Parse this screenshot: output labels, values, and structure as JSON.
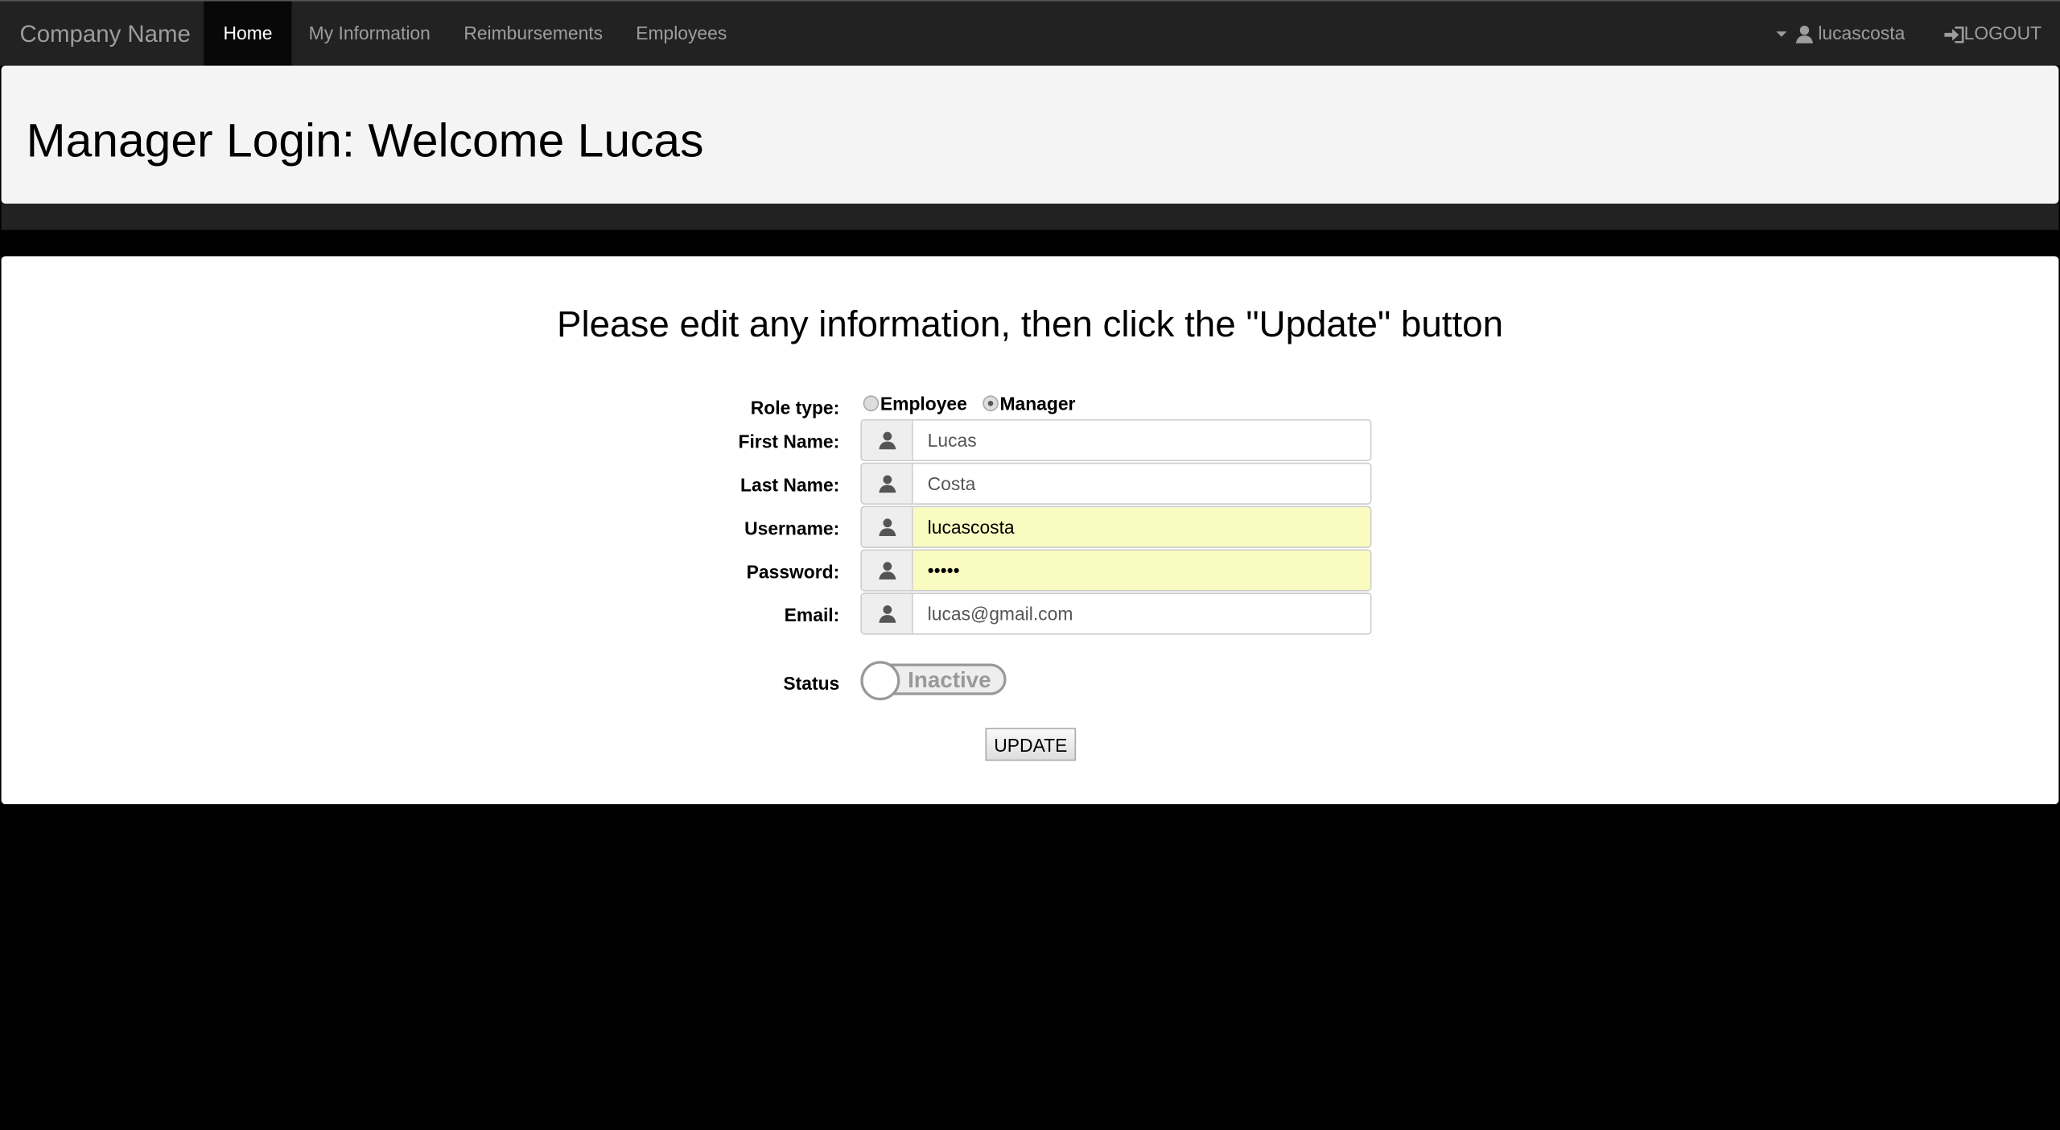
{
  "navbar": {
    "brand": "Company Name",
    "links": [
      {
        "label": "Home",
        "active": true
      },
      {
        "label": "My Information"
      },
      {
        "label": "Reimbursements"
      },
      {
        "label": "Employees"
      }
    ],
    "user": "lucascosta",
    "logout": "LOGOUT"
  },
  "jumbotron": {
    "title": "Manager Login: Welcome Lucas"
  },
  "form": {
    "heading": "Please edit any information, then click the \"Update\" button",
    "role_label": "Role type:",
    "roles": [
      {
        "label": "Employee",
        "checked": false
      },
      {
        "label": "Manager",
        "checked": true
      }
    ],
    "fields": [
      {
        "label": "First Name:",
        "value": "Lucas"
      },
      {
        "label": "Last Name:",
        "value": "Costa"
      },
      {
        "label": "Username:",
        "value": "lucascosta"
      },
      {
        "label": "Password:",
        "value": "•••••"
      },
      {
        "label": "Email:",
        "value": "lucas@gmail.com"
      }
    ],
    "status_label": "Status",
    "status_value": "Inactive",
    "update_button": "UPDATE"
  }
}
